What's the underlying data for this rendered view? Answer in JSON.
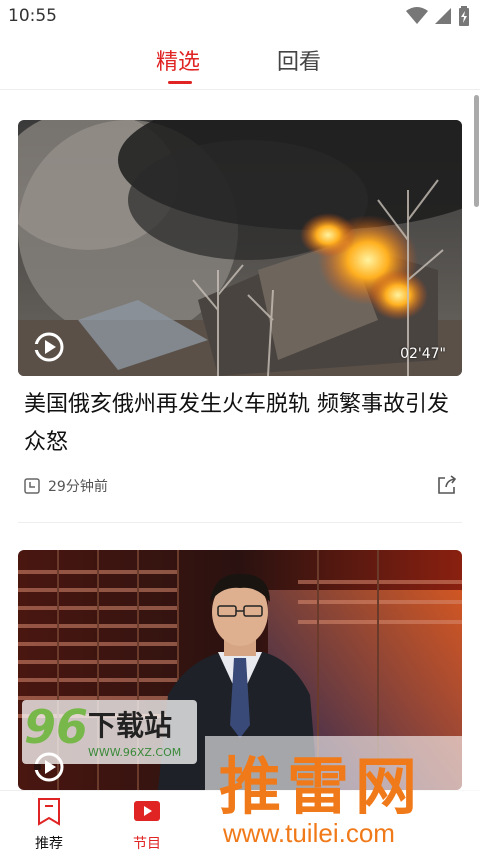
{
  "status_bar": {
    "time": "10:55",
    "icons": [
      "wifi-icon",
      "signal-icon",
      "battery-charging-icon"
    ]
  },
  "tabs": [
    {
      "label": "精选",
      "active": true
    },
    {
      "label": "回看",
      "active": false
    }
  ],
  "cards": [
    {
      "duration": "02'47\"",
      "title": "美国俄亥俄州再发生火车脱轨 频繁事故引发众怒",
      "time_ago": "29分钟前",
      "icons": [
        "play-icon",
        "clock-icon",
        "share-icon"
      ]
    },
    {
      "icons": [
        "play-icon"
      ]
    }
  ],
  "bottom_nav": [
    {
      "label": "推荐",
      "icon": "bookmark-icon",
      "active": false
    },
    {
      "label": "节目",
      "icon": "tv-play-icon",
      "active": true
    }
  ],
  "watermarks": {
    "site96": {
      "number": "96",
      "text": "下载站",
      "url": "WWW.96XZ.COM"
    },
    "tuilei": {
      "text": "推雷网",
      "url": "www.tuilei.com"
    }
  },
  "colors": {
    "accent": "#e02424",
    "watermark_orange": "#f07a1a",
    "watermark_green": "#78b84b"
  }
}
